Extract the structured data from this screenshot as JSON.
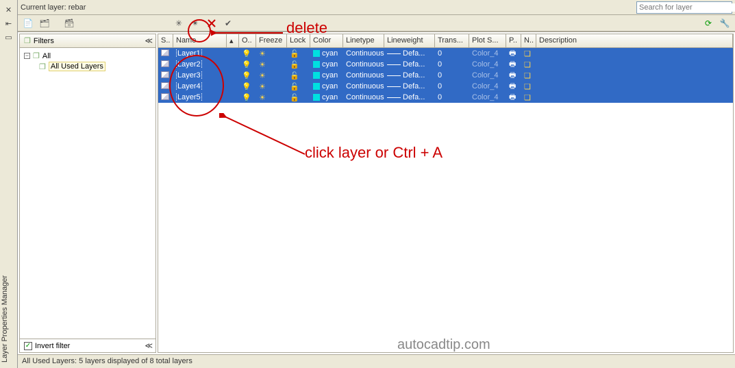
{
  "palette_title": "Layer Properties Manager",
  "current_layer_label": "Current layer: rebar",
  "search_placeholder": "Search for layer",
  "filters": {
    "title": "Filters",
    "root": "All",
    "child": "All Used Layers"
  },
  "invert_filter": "Invert filter",
  "columns": {
    "status": "S..",
    "name": "Name",
    "on": "O..",
    "freeze": "Freeze",
    "lock": "Lock",
    "color": "Color",
    "linetype": "Linetype",
    "lineweight": "Lineweight",
    "trans": "Trans...",
    "plotstyle": "Plot S...",
    "p": "P..",
    "n": "N..",
    "desc": "Description"
  },
  "layers": [
    {
      "name": "Layer1",
      "color": "cyan",
      "linetype": "Continuous",
      "lineweight": "Defa...",
      "trans": "0",
      "plotstyle": "Color_4"
    },
    {
      "name": "Layer2",
      "color": "cyan",
      "linetype": "Continuous",
      "lineweight": "Defa...",
      "trans": "0",
      "plotstyle": "Color_4"
    },
    {
      "name": "Layer3",
      "color": "cyan",
      "linetype": "Continuous",
      "lineweight": "Defa...",
      "trans": "0",
      "plotstyle": "Color_4"
    },
    {
      "name": "Layer4",
      "color": "cyan",
      "linetype": "Continuous",
      "lineweight": "Defa...",
      "trans": "0",
      "plotstyle": "Color_4"
    },
    {
      "name": "Layer5",
      "color": "cyan",
      "linetype": "Continuous",
      "lineweight": "Defa...",
      "trans": "0",
      "plotstyle": "Color_4"
    }
  ],
  "status_text": "All Used Layers: 5 layers displayed of 8 total layers",
  "annotations": {
    "delete": "delete",
    "click_layer": "click layer or Ctrl + A",
    "watermark": "autocadtip.com"
  }
}
